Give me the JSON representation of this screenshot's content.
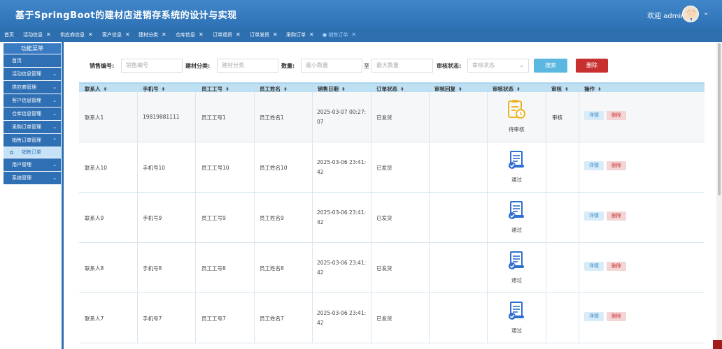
{
  "app": {
    "title": "基于SpringBoot的建材店进销存系统的设计与实现",
    "welcome": "欢迎 admin"
  },
  "tabs": [
    {
      "label": "首页",
      "closable": false
    },
    {
      "label": "活动信息",
      "closable": true
    },
    {
      "label": "供应商信息",
      "closable": true
    },
    {
      "label": "客户信息",
      "closable": true
    },
    {
      "label": "建材分类",
      "closable": true
    },
    {
      "label": "仓库信息",
      "closable": true
    },
    {
      "label": "订单退货",
      "closable": true
    },
    {
      "label": "订单发货",
      "closable": true
    },
    {
      "label": "采购订单",
      "closable": true
    },
    {
      "label": "销售订单",
      "closable": true,
      "active": true
    }
  ],
  "sidebar": {
    "title": "功能菜单",
    "items": [
      {
        "label": "首页"
      },
      {
        "label": "活动信息管理"
      },
      {
        "label": "供应商管理"
      },
      {
        "label": "客户信息管理"
      },
      {
        "label": "仓库信息管理"
      },
      {
        "label": "采购订单管理"
      },
      {
        "label": "销售订单管理",
        "expanded": true
      },
      {
        "label": "销售订单",
        "sub": true
      },
      {
        "label": "用户管理"
      },
      {
        "label": "系统管理"
      }
    ]
  },
  "search": {
    "sale_no_label": "销售编号:",
    "sale_no_placeholder": "销售编号",
    "category_label": "建材分类:",
    "category_placeholder": "建材分类",
    "qty_label": "数量:",
    "qty_min_placeholder": "最小数量",
    "qty_to": "至",
    "qty_max_placeholder": "最大数量",
    "audit_label": "审核状态:",
    "audit_placeholder": "审核状态",
    "search_button": "搜索",
    "delete_button": "删除"
  },
  "table": {
    "headers": [
      "联系人",
      "手机号",
      "员工工号",
      "员工姓名",
      "销售日期",
      "订单状态",
      "审核回复",
      "审核状态",
      "审核",
      "操作"
    ],
    "rows": [
      {
        "contact": "联系人1",
        "phone": "19819881111",
        "emp_no": "员工工号1",
        "emp_name": "员工姓名1",
        "date": "2025-03-07 00:27:07",
        "order_status": "已发货",
        "reply": "",
        "audit_status": "待审核",
        "audit": "审核",
        "pending": true
      },
      {
        "contact": "联系人10",
        "phone": "手机号10",
        "emp_no": "员工工号10",
        "emp_name": "员工姓名10",
        "date": "2025-03-06 23:41:42",
        "order_status": "已发货",
        "reply": "",
        "audit_status": "通过",
        "audit": ""
      },
      {
        "contact": "联系人9",
        "phone": "手机号9",
        "emp_no": "员工工号9",
        "emp_name": "员工姓名9",
        "date": "2025-03-06 23:41:42",
        "order_status": "已发货",
        "reply": "",
        "audit_status": "通过",
        "audit": ""
      },
      {
        "contact": "联系人8",
        "phone": "手机号8",
        "emp_no": "员工工号8",
        "emp_name": "员工姓名8",
        "date": "2025-03-06 23:41:42",
        "order_status": "已发货",
        "reply": "",
        "audit_status": "通过",
        "audit": ""
      },
      {
        "contact": "联系人7",
        "phone": "手机号7",
        "emp_no": "员工工号7",
        "emp_name": "员工姓名7",
        "date": "2025-03-06 23:41:42",
        "order_status": "已发货",
        "reply": "",
        "audit_status": "通过",
        "audit": ""
      }
    ],
    "detail_label": "详情",
    "delete_label": "删除"
  },
  "colors": {
    "header": "#2f72b6",
    "accent": "#5bb7e0",
    "danger": "#c7302f",
    "pending_icon": "#f0b323",
    "pass_icon": "#2f6fd0"
  }
}
